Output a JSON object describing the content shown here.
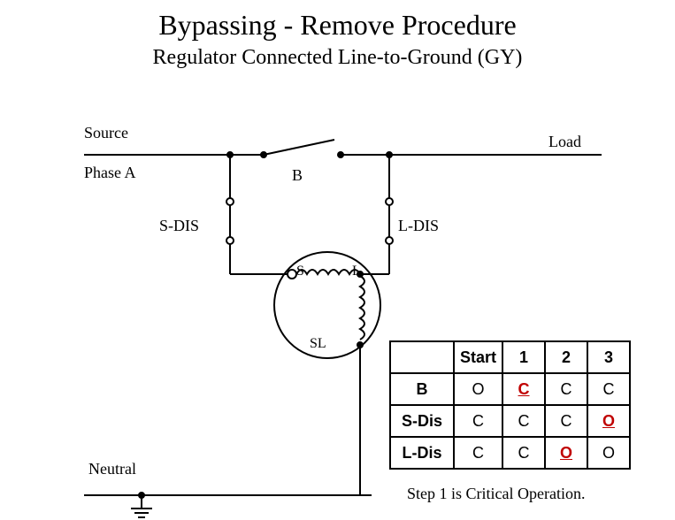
{
  "title": "Bypassing - Remove Procedure",
  "subtitle": "Regulator Connected Line-to-Ground (GY)",
  "labels": {
    "source": "Source",
    "load": "Load",
    "phaseA": "Phase A",
    "B": "B",
    "sdis": "S-DIS",
    "ldis": "L-DIS",
    "S": "S",
    "L": "L",
    "SL": "SL",
    "neutral": "Neutral"
  },
  "table": {
    "headers": [
      "Start",
      "1",
      "2",
      "3"
    ],
    "rows": [
      {
        "name": "B",
        "cells": [
          {
            "v": "O"
          },
          {
            "v": "C",
            "crit": true
          },
          {
            "v": "C"
          },
          {
            "v": "C"
          }
        ]
      },
      {
        "name": "S-Dis",
        "cells": [
          {
            "v": "C"
          },
          {
            "v": "C"
          },
          {
            "v": "C"
          },
          {
            "v": "O",
            "crit": true
          }
        ]
      },
      {
        "name": "L-Dis",
        "cells": [
          {
            "v": "C"
          },
          {
            "v": "C"
          },
          {
            "v": "O",
            "crit": true
          },
          {
            "v": "O"
          }
        ]
      }
    ]
  },
  "footnote": "Step 1 is Critical Operation."
}
